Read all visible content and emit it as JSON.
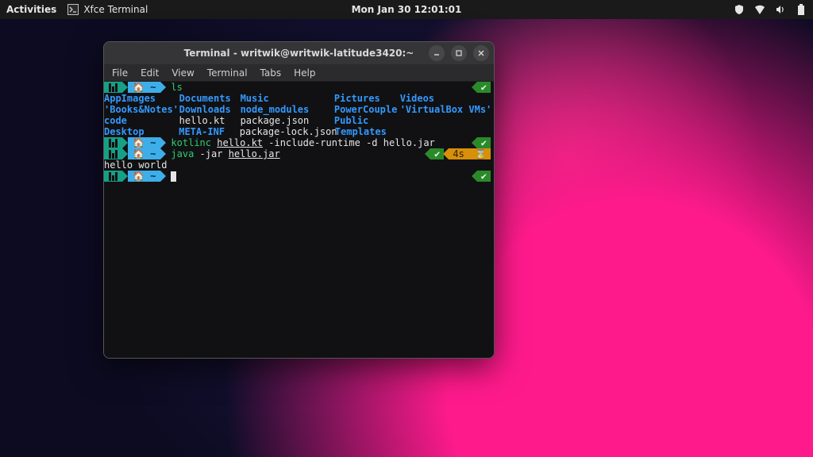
{
  "topbar": {
    "activities": "Activities",
    "app_name": "Xfce Terminal",
    "clock": "Mon Jan 30  12:01:01"
  },
  "window": {
    "title": "Terminal - writwik@writwik-latitude3420:~"
  },
  "menu": {
    "file": "File",
    "edit": "Edit",
    "view": "View",
    "terminal": "Terminal",
    "tabs": "Tabs",
    "help": "Help"
  },
  "prompt": {
    "home_icon": "🏠",
    "path": "~",
    "ok": "✔",
    "elapsed": "4s",
    "hourglass": "⌛"
  },
  "cmds": {
    "ls": "ls",
    "kotlinc_cmd": "kotlinc",
    "kotlinc_file": "hello.kt",
    "kotlinc_rest": " -include-runtime -d hello.jar",
    "java_cmd": "java",
    "java_flag": " -jar ",
    "java_file": "hello.jar"
  },
  "output": {
    "hello": "hello world"
  },
  "ls": {
    "r0": {
      "c0": "AppImages",
      "c1": "Documents",
      "c2": "Music",
      "c3": "Pictures",
      "c4": "Videos"
    },
    "r1": {
      "c0": "'Books&Notes'",
      "c1": "Downloads",
      "c2": "node_modules",
      "c3": "PowerCouple",
      "c4": "'VirtualBox VMs'"
    },
    "r2": {
      "c0": "code",
      "c1": "hello.kt",
      "c2": "package.json",
      "c3": "Public",
      "c4": ""
    },
    "r3": {
      "c0": "Desktop",
      "c1": "META-INF",
      "c2": "package-lock.json",
      "c3": "Templates",
      "c4": ""
    }
  }
}
